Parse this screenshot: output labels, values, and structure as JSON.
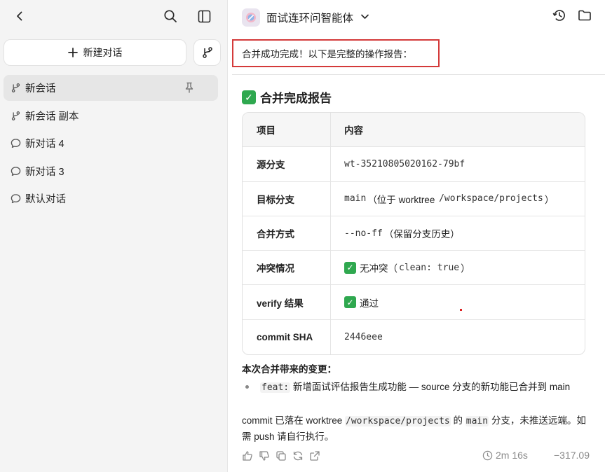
{
  "sidebar": {
    "new_chat_label": "新建对话",
    "conversations": [
      {
        "label": "新会话",
        "icon": "branch-icon",
        "active": true
      },
      {
        "label": "新会话 副本",
        "icon": "branch-icon",
        "active": false
      },
      {
        "label": "新对话 4",
        "icon": "chat-bubble-icon",
        "active": false
      },
      {
        "label": "新对话 3",
        "icon": "chat-bubble-icon",
        "active": false
      },
      {
        "label": "默认对话",
        "icon": "chat-bubble-icon",
        "active": false
      }
    ]
  },
  "header": {
    "agent_name": "面试连环问智能体"
  },
  "message": {
    "intro": "合并成功完成！以下是完整的操作报告：",
    "report_title": "合并完成报告",
    "table": {
      "headers": [
        "项目",
        "内容"
      ],
      "rows": [
        {
          "label": "源分支",
          "code": "wt-35210805020162-79bf"
        },
        {
          "label": "目标分支",
          "code_a": "main",
          "text_a": "（位于 worktree ",
          "code_b": "/workspace/projects",
          "text_b": "）"
        },
        {
          "label": "合并方式",
          "code_a": "--no-ff",
          "text_a": "（保留分支历史）"
        },
        {
          "label": "冲突情况",
          "text_a": "无冲突（",
          "code_a": "clean: true",
          "text_b": "）"
        },
        {
          "label": "verify 结果",
          "text_a": "通过"
        },
        {
          "label": "commit SHA",
          "code": "2446eee"
        }
      ]
    },
    "changes_title": "本次合并带来的变更：",
    "bullet": {
      "code": "feat:",
      "text": " 新增面试评估报告生成功能 — source 分支的新功能已合并到 main"
    },
    "note": {
      "t1": "commit 已落在 worktree ",
      "c1": "/workspace/projects",
      "t2": " 的 ",
      "c2": "main",
      "t3": " 分支，未推送远端。如需 push 请自行执行。"
    }
  },
  "footer": {
    "duration": "2m 16s",
    "score": "−317.09"
  },
  "colors": {
    "accent_red": "#d43a3a",
    "check_green": "#2fa84f"
  }
}
